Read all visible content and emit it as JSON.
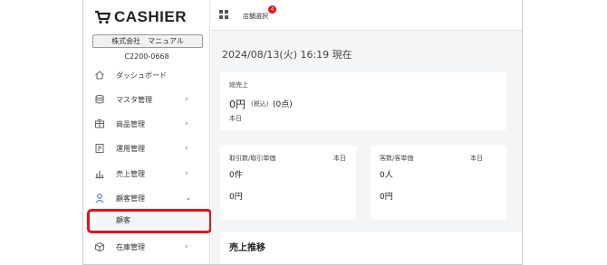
{
  "app": {
    "logo_text": "CASHIER"
  },
  "sidebar": {
    "company_name": "株式会社　マニュアル",
    "company_code": "C2200-0668",
    "items": [
      {
        "label": "ダッシュボード",
        "icon": "home-icon",
        "chevron": ""
      },
      {
        "label": "マスタ管理",
        "icon": "database-icon",
        "chevron": "›"
      },
      {
        "label": "商品管理",
        "icon": "product-icon",
        "chevron": "›"
      },
      {
        "label": "運用管理",
        "icon": "document-icon",
        "chevron": "›"
      },
      {
        "label": "売上管理",
        "icon": "bar-chart-icon",
        "chevron": "›"
      },
      {
        "label": "顧客管理",
        "icon": "user-icon",
        "chevron": "⌄"
      },
      {
        "label": "在庫管理",
        "icon": "box-icon",
        "chevron": "›"
      }
    ],
    "sub_item": {
      "label": "顧客"
    },
    "highlight_color": "#e8101b"
  },
  "topbar": {
    "store_label": "店舗選択",
    "badge_count": "4"
  },
  "main": {
    "datetime": "2024/08/13(火) 16:19 現在",
    "total_sales": {
      "title": "総売上",
      "value": "0円",
      "tax": "(税込)",
      "count": "(0点)",
      "period": "本日"
    },
    "transactions": {
      "title": "取引数/取引単価",
      "period": "本日",
      "count": "0件",
      "amount": "0円"
    },
    "customers": {
      "title": "客数/客単価",
      "period": "本日",
      "count": "0人",
      "amount": "0円"
    },
    "sales_trend": {
      "title": "売上推移"
    }
  }
}
